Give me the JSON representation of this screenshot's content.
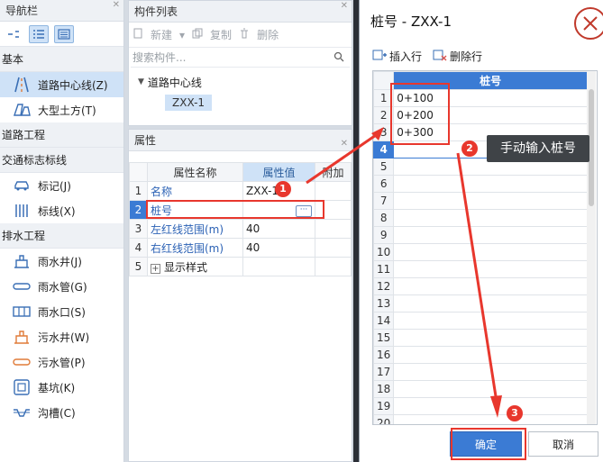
{
  "nav": {
    "title": "导航栏",
    "categories": [
      {
        "label": "基本",
        "items": [
          {
            "label": "道路中心线(Z)"
          },
          {
            "label": "大型土方(T)"
          }
        ]
      },
      {
        "label": "道路工程",
        "items": []
      },
      {
        "label": "交通标志标线",
        "items": [
          {
            "label": "标记(J)"
          },
          {
            "label": "标线(X)"
          }
        ]
      },
      {
        "label": "排水工程",
        "items": [
          {
            "label": "雨水井(J)"
          },
          {
            "label": "雨水管(G)"
          },
          {
            "label": "雨水口(S)"
          },
          {
            "label": "污水井(W)"
          },
          {
            "label": "污水管(P)"
          },
          {
            "label": "基坑(K)"
          },
          {
            "label": "沟槽(C)"
          }
        ]
      }
    ]
  },
  "components": {
    "title": "构件列表",
    "toolbar": {
      "new": "新建",
      "copy": "复制",
      "delete": "删除"
    },
    "search_placeholder": "搜索构件...",
    "tree": {
      "parent": "道路中心线",
      "child": "ZXX-1"
    }
  },
  "properties": {
    "title": "属性",
    "headers": {
      "name": "属性名称",
      "value": "属性值",
      "extra": "附加"
    },
    "rows": [
      {
        "num": "1",
        "name": "名称",
        "value": "ZXX-1"
      },
      {
        "num": "2",
        "name": "桩号",
        "value": ""
      },
      {
        "num": "3",
        "name": "左红线范围(m)",
        "value": "40"
      },
      {
        "num": "4",
        "name": "右红线范围(m)",
        "value": "40"
      },
      {
        "num": "5",
        "name": "显示样式",
        "value": ""
      }
    ]
  },
  "dialog": {
    "title": "桩号 - ZXX-1",
    "toolbar": {
      "insert": "插入行",
      "delete": "删除行"
    },
    "column": "桩号",
    "rows": [
      "0+100",
      "0+200",
      "0+300",
      "",
      "",
      "",
      "",
      "",
      "",
      "",
      "",
      "",
      "",
      "",
      "",
      "",
      "",
      "",
      "",
      ""
    ],
    "ok": "确定",
    "cancel": "取消"
  },
  "annotations": {
    "step1": "1",
    "step2": "2",
    "step3": "3",
    "tip": "手动输入桩号",
    "color": "#e8372d"
  }
}
